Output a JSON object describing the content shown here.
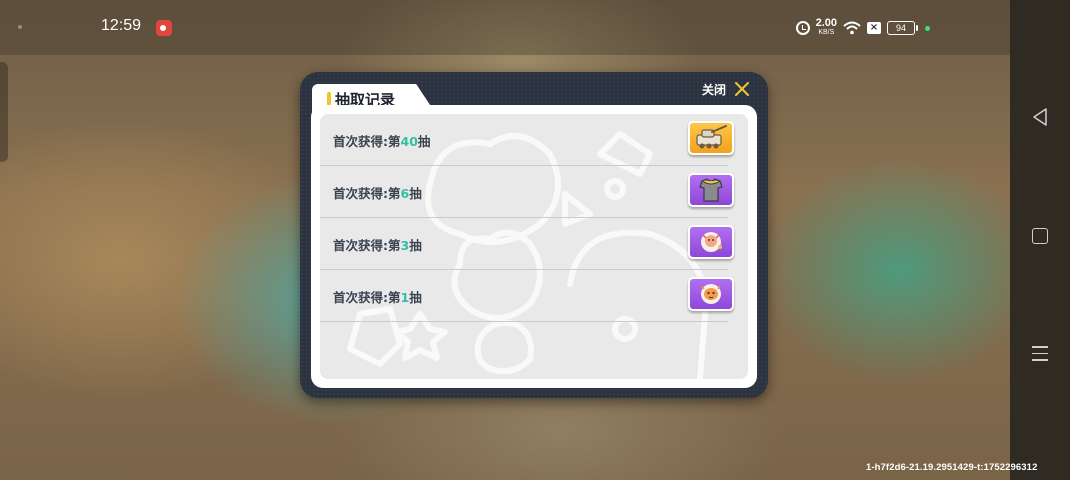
{
  "status_bar": {
    "time": "12:59",
    "net_speed": "2.00",
    "net_unit": "KB/S",
    "battery": "94"
  },
  "modal": {
    "title": "抽取记录",
    "close_label": "关闭",
    "records": [
      {
        "prefix": "首次获得:第",
        "number": "40",
        "suffix": "抽",
        "item_icon": "tank-sticker-icon",
        "rarity_color": "#f5b029"
      },
      {
        "prefix": "首次获得:第",
        "number": "6",
        "suffix": "抽",
        "item_icon": "shirt-icon",
        "rarity_color": "#9a52e0"
      },
      {
        "prefix": "首次获得:第",
        "number": "3",
        "suffix": "抽",
        "item_icon": "character-sticker-icon",
        "rarity_color": "#9a52e0"
      },
      {
        "prefix": "首次获得:第",
        "number": "1",
        "suffix": "抽",
        "item_icon": "mascot-sticker-icon",
        "rarity_color": "#9a52e0"
      }
    ]
  },
  "build_id": "1-h7f2d6-21.19.2951429-t:1752296312",
  "colors": {
    "accent_yellow": "#f4c430",
    "number_teal": "#2fc0a5",
    "modal_dark": "#2c3340"
  }
}
